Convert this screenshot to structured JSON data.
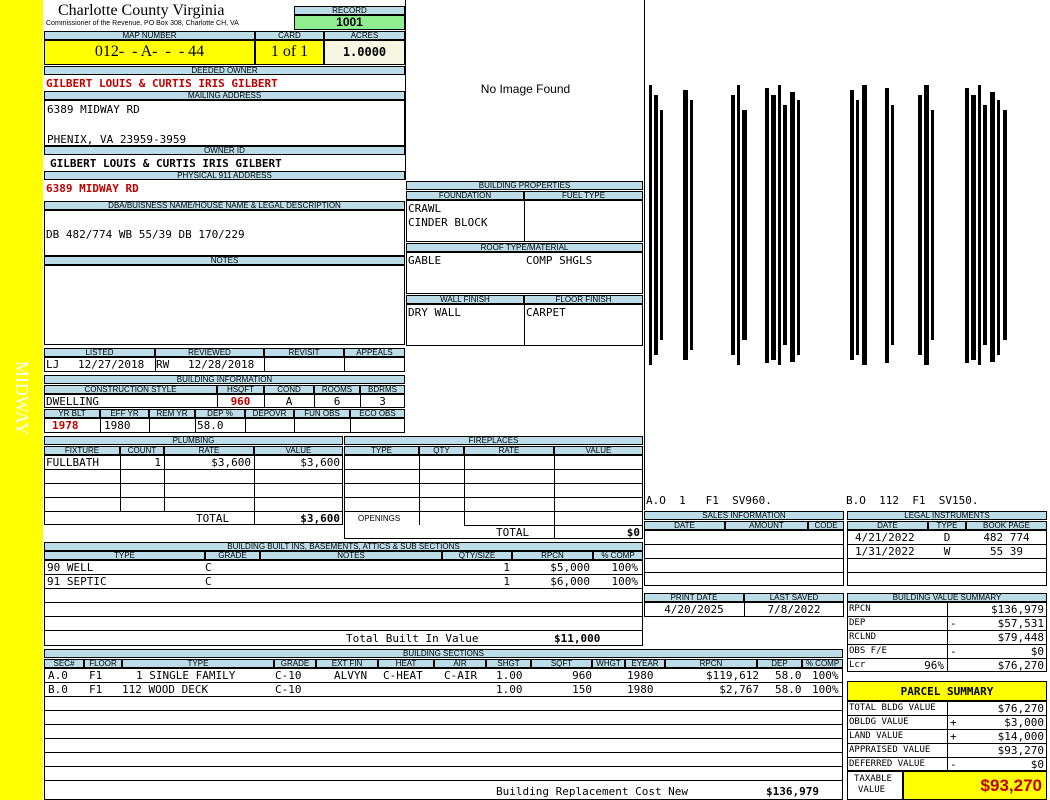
{
  "side_label": "MIDWAY",
  "county": {
    "title": "Charlotte County Virginia",
    "subtitle": "Commissioner of the Revenue, PO Box 308, Charlotte CH, VA"
  },
  "record": {
    "label": "RECORD",
    "value": "1001"
  },
  "map_number": {
    "label": "MAP NUMBER",
    "value": "012-  - A-  -  - 44"
  },
  "card": {
    "label": "CARD",
    "value": "1 of 1"
  },
  "acres": {
    "label": "ACRES",
    "value": "1.0000"
  },
  "deeded_owner": {
    "label": "DEEDED OWNER",
    "value": "GILBERT LOUIS & CURTIS IRIS GILBERT"
  },
  "mailing": {
    "label": "MAILING ADDRESS",
    "line1": "6389 MIDWAY RD",
    "line2": "PHENIX, VA 23959-3959"
  },
  "owner_id": {
    "label": "OWNER ID",
    "value": "GILBERT LOUIS & CURTIS IRIS GILBERT"
  },
  "physical": {
    "label": "PHYSICAL 911 ADDRESS",
    "value": "6389 MIDWAY RD"
  },
  "dba": {
    "label": "DBA/BUISNESS NAME/HOUSE NAME & LEGAL DESCRIPTION",
    "value": "DB 482/774 WB 55/39 DB 170/229"
  },
  "notes": {
    "label": "NOTES"
  },
  "image": {
    "no_image": "No Image Found"
  },
  "review": {
    "listed_label": "LISTED",
    "reviewed_label": "REVIEWED",
    "revisit_label": "REVISIT",
    "appeals_label": "APPEALS",
    "listed_by": "LJ",
    "listed_date": "12/27/2018",
    "reviewed_by": "RW",
    "reviewed_date": "12/28/2018"
  },
  "building_info": {
    "label": "BUILDING INFORMATION",
    "construction_label": "CONSTRUCTION STYLE",
    "hsqft_label": "HSQFT",
    "cond_label": "COND",
    "rooms_label": "ROOMS",
    "bdrms_label": "BDRMS",
    "construction": "DWELLING",
    "hsqft": "960",
    "cond": "A",
    "rooms": "6",
    "bdrms": "3",
    "yrblt_label": "YR BLT",
    "effyr_label": "EFF YR",
    "remyr_label": "REM YR",
    "dep_label": "DEP %",
    "depovr_label": "DEPOVR",
    "funobs_label": "FUN OBS",
    "ecoobs_label": "ECO OBS",
    "yrblt": "1978",
    "effyr": "1980",
    "dep": "58.0"
  },
  "building_props": {
    "label": "BUILDING PROPERTIES",
    "foundation_label": "FOUNDATION",
    "fueltype_label": "FUEL TYPE",
    "foundation_1": "CRAWL",
    "foundation_2": "CINDER BLOCK",
    "roof_label": "ROOF TYPE/MATERIAL",
    "roof_type": "GABLE",
    "roof_material": "COMP SHGLS",
    "wall_label": "WALL FINISH",
    "floor_label": "FLOOR FINISH",
    "wall": "DRY WALL",
    "floor": "CARPET"
  },
  "sketch": {
    "labels": [
      "A.O  1   F1  SV960.",
      "B.O  112  F1  SV150."
    ]
  },
  "plumbing": {
    "label": "PLUMBING",
    "cols": [
      "FIXTURE",
      "COUNT",
      "RATE",
      "VALUE"
    ],
    "rows": [
      [
        "FULLBATH",
        "1",
        "$3,600",
        "$3,600"
      ]
    ],
    "total_label": "TOTAL",
    "total": "$3,600"
  },
  "fireplaces": {
    "label": "FIREPLACES",
    "cols": [
      "TYPE",
      "QTY",
      "RATE",
      "VALUE"
    ],
    "openings_label": "OPENINGS",
    "total_label": "TOTAL",
    "total": "$0"
  },
  "sales": {
    "label": "SALES INFORMATION",
    "cols": [
      "DATE",
      "AMOUNT",
      "CODE"
    ]
  },
  "legal": {
    "label": "LEGAL INSTRUMENTS",
    "cols": [
      "DATE",
      "TYPE",
      "BOOK PAGE"
    ],
    "rows": [
      [
        "4/21/2022",
        "D",
        "482 774"
      ],
      [
        "1/31/2022",
        "W",
        "55 39"
      ]
    ]
  },
  "builtins": {
    "label": "BUILDING BUILT INS, BASEMENTS, ATTICS & SUB SECTIONS",
    "cols": [
      "TYPE",
      "GRADE",
      "NOTES",
      "QTY/SIZE",
      "RPCN",
      "% COMP"
    ],
    "rows": [
      [
        "90 WELL",
        "C",
        "",
        "1",
        "$5,000",
        "100%"
      ],
      [
        "91 SEPTIC",
        "C",
        "",
        "1",
        "$6,000",
        "100%"
      ]
    ],
    "total_label": "Total Built In Value",
    "total": "$11,000"
  },
  "print": {
    "print_label": "PRINT DATE",
    "saved_label": "LAST SAVED",
    "print_date": "4/20/2025",
    "last_saved": "7/8/2022"
  },
  "value_summary": {
    "label": "BUILDING VALUE SUMMARY",
    "rows": [
      {
        "label": "RPCN",
        "sign": "",
        "value": "$136,979"
      },
      {
        "label": "DEP",
        "sign": "-",
        "value": "$57,531"
      },
      {
        "label": "RCLND",
        "sign": "",
        "value": "$79,448"
      },
      {
        "label": "OBS F/E",
        "sign": "-",
        "value": "$0"
      },
      {
        "label": "Lcr",
        "sign": "96%",
        "value": "$76,270"
      }
    ]
  },
  "sections": {
    "label": "BUILDING SECTIONS",
    "cols": [
      "SEC#",
      "FLOOR",
      "TYPE",
      "GRADE",
      "EXT FIN",
      "HEAT",
      "AIR",
      "SHGT",
      "SQFT",
      "WHGT",
      "EYEAR",
      "RPCN",
      "DEP",
      "% COMP"
    ],
    "rows": [
      [
        "A.0",
        "F1",
        "1 SINGLE FAMILY",
        "C-10",
        "ALVYN",
        "C-HEAT",
        "C-AIR",
        "1.00",
        "960",
        "",
        "1980",
        "$119,612",
        "58.0",
        "100%"
      ],
      [
        "B.0",
        "F1",
        "112 WOOD DECK",
        "C-10",
        "",
        "",
        "",
        "1.00",
        "150",
        "",
        "1980",
        "$2,767",
        "58.0",
        "100%"
      ]
    ],
    "replacement_label": "Building Replacement Cost New",
    "replacement": "$136,979"
  },
  "parcel": {
    "label": "PARCEL SUMMARY",
    "rows": [
      {
        "label": "TOTAL BLDG VALUE",
        "sign": "",
        "value": "$76,270"
      },
      {
        "label": "OBLDG VALUE",
        "sign": "+",
        "value": "$3,000"
      },
      {
        "label": "LAND VALUE",
        "sign": "+",
        "value": "$14,000"
      },
      {
        "label": "APPRAISED VALUE",
        "sign": "",
        "value": "$93,270"
      },
      {
        "label": "DEFERRED VALUE",
        "sign": "-",
        "value": "$0"
      }
    ],
    "taxable_label_1": "TAXABLE",
    "taxable_label_2": "VALUE",
    "taxable": "$93,270"
  },
  "colors": {
    "yellow": "#ffff00",
    "header_blue": "#bcdce8",
    "record_green": "#90ee90",
    "red": "#c00000"
  }
}
